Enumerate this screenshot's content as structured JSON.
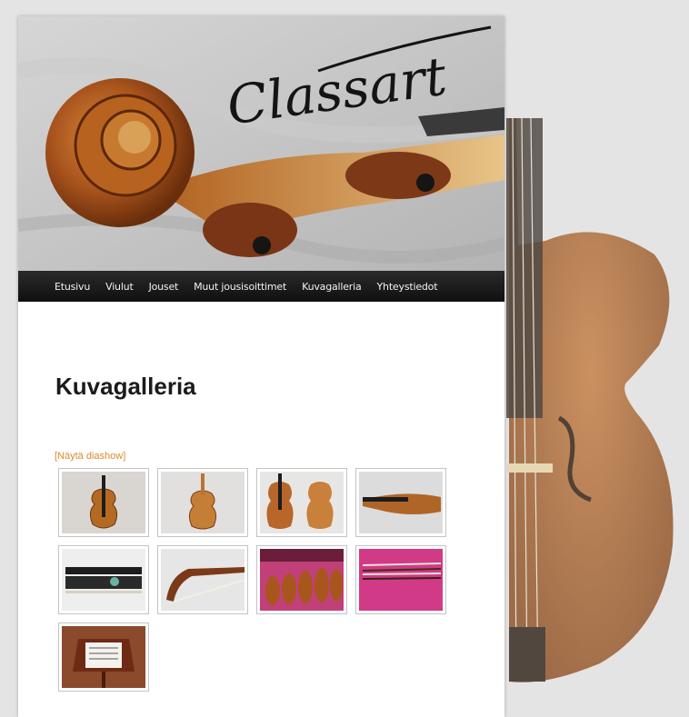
{
  "site": {
    "logo_text": "Classart"
  },
  "nav": {
    "items": [
      "Etusivu",
      "Viulut",
      "Jouset",
      "Muut jousisoittimet",
      "Kuvagalleria",
      "Yhteystiedot"
    ]
  },
  "page": {
    "title": "Kuvagalleria",
    "slideshow_link": "[Näytä diashow]"
  },
  "gallery": {
    "thumbnails": [
      "violin-front-thumbnail",
      "violin-back-thumbnail",
      "violin-front-and-back-thumbnail",
      "violin-side-thumbnail",
      "bow-frog-thumbnail",
      "bow-tip-thumbnail",
      "violins-on-pink-cloth-thumbnail",
      "bows-on-pink-cloth-thumbnail",
      "music-stand-thumbnail"
    ]
  },
  "colors": {
    "nav_bg": "#111111",
    "link": "#d98a2b",
    "title": "#1b1b1b"
  }
}
